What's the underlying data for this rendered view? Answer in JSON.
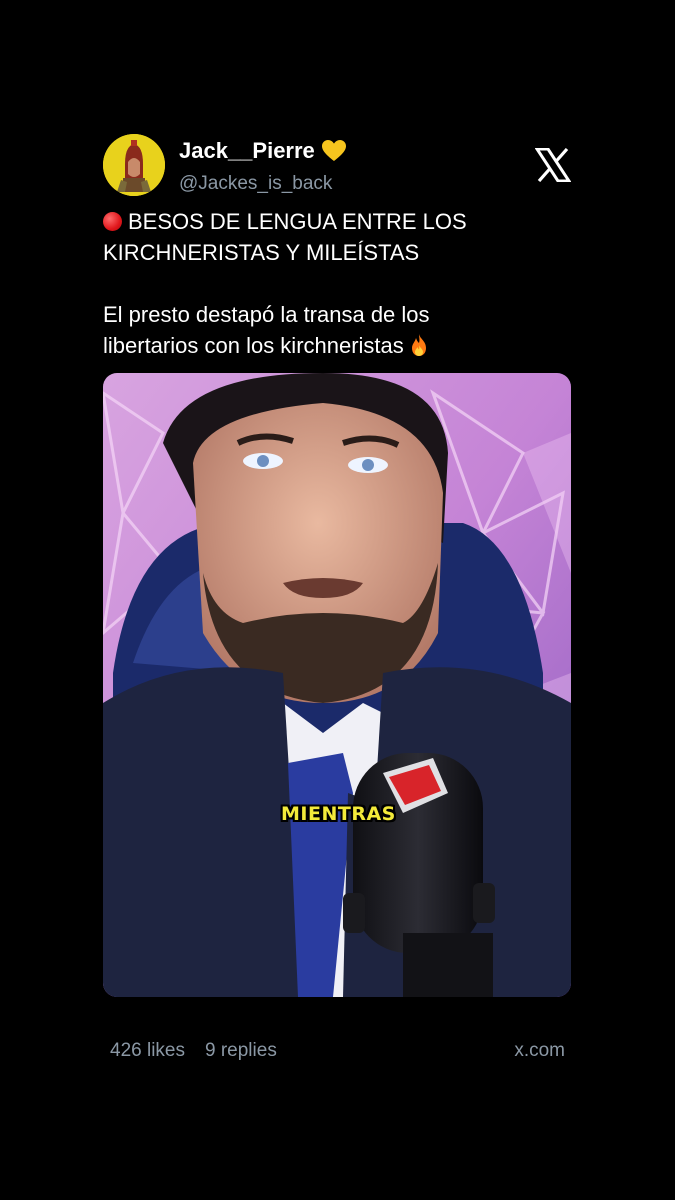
{
  "author": {
    "display_name": "Jack__Pierre",
    "handle": "@Jackes_is_back",
    "badge_icon": "yellow-heart-icon",
    "avatar_icon": "avatar-image"
  },
  "brand_icon": "x-logo-icon",
  "post": {
    "headline_icon": "red-circle-icon",
    "lines": [
      "BESOS DE LENGUA ENTRE LOS",
      "KIRCHNERISTAS Y MILEÍSTAS",
      "El presto destapó la transa de los",
      "libertarios con los kirchneristas"
    ],
    "trailing_icon": "fire-icon"
  },
  "media": {
    "type": "video-still",
    "caption": "MIENTRAS",
    "mic_label": "E!"
  },
  "footer": {
    "likes": "426 likes",
    "replies": "9 replies",
    "domain": "x.com"
  },
  "colors": {
    "background": "#000000",
    "text": "#ffffff",
    "muted": "#8b98a5",
    "avatar_bg": "#e8d21c",
    "caption": "#f3ea3a"
  }
}
